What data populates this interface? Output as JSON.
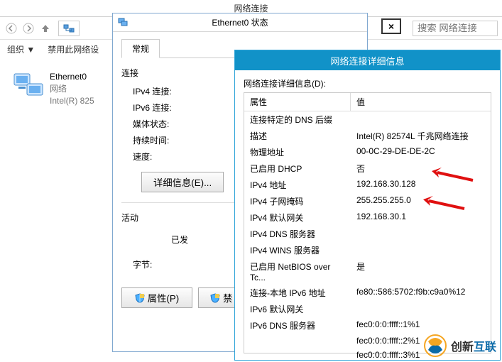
{
  "main_window": {
    "title": "网络连接",
    "search_placeholder": "搜索 网络连接",
    "org_label": "组织",
    "disable_label": "禁用此网络设",
    "dropdown_glyph": "▼"
  },
  "adapter": {
    "name": "Ethernet0",
    "status": "网络",
    "device": "Intel(R) 825"
  },
  "status_dialog": {
    "title": "Ethernet0 状态",
    "close_glyph": "×",
    "tab_general": "常规",
    "section_connection": "连接",
    "ipv4_label": "IPv4 连接:",
    "ipv6_label": "IPv6 连接:",
    "media_label": "媒体状态:",
    "duration_label": "持续时间:",
    "speed_label": "速度:",
    "details_button": "详细信息(E)...",
    "section_activity": "活动",
    "sent_label": "已发",
    "bytes_label": "字节:",
    "btn_properties": "属性(P)",
    "btn_disable": "禁"
  },
  "details_dialog": {
    "title": "网络连接详细信息",
    "caption": "网络连接详细信息(D):",
    "col_property": "属性",
    "col_value": "值",
    "rows": [
      {
        "prop": "连接特定的 DNS 后缀",
        "val": ""
      },
      {
        "prop": "描述",
        "val": "Intel(R) 82574L 千兆网络连接"
      },
      {
        "prop": "物理地址",
        "val": "00-0C-29-DE-DE-2C"
      },
      {
        "prop": "已启用 DHCP",
        "val": "否"
      },
      {
        "prop": "IPv4 地址",
        "val": "192.168.30.128"
      },
      {
        "prop": "IPv4 子网掩码",
        "val": "255.255.255.0"
      },
      {
        "prop": "IPv4 默认网关",
        "val": "192.168.30.1"
      },
      {
        "prop": "IPv4 DNS 服务器",
        "val": ""
      },
      {
        "prop": "IPv4 WINS 服务器",
        "val": ""
      },
      {
        "prop": "已启用 NetBIOS over Tc...",
        "val": "是"
      },
      {
        "prop": "连接-本地 IPv6 地址",
        "val": "fe80::586:5702:f9b:c9a0%12"
      },
      {
        "prop": "IPv6 默认网关",
        "val": ""
      },
      {
        "prop": "IPv6 DNS 服务器",
        "val": "fec0:0:0:ffff::1%1"
      },
      {
        "prop": "",
        "val": "fec0:0:0:ffff::2%1"
      },
      {
        "prop": "",
        "val": "fec0:0:0:ffff::3%1"
      }
    ]
  },
  "watermark": {
    "text1": "创新",
    "text2": "互联"
  }
}
